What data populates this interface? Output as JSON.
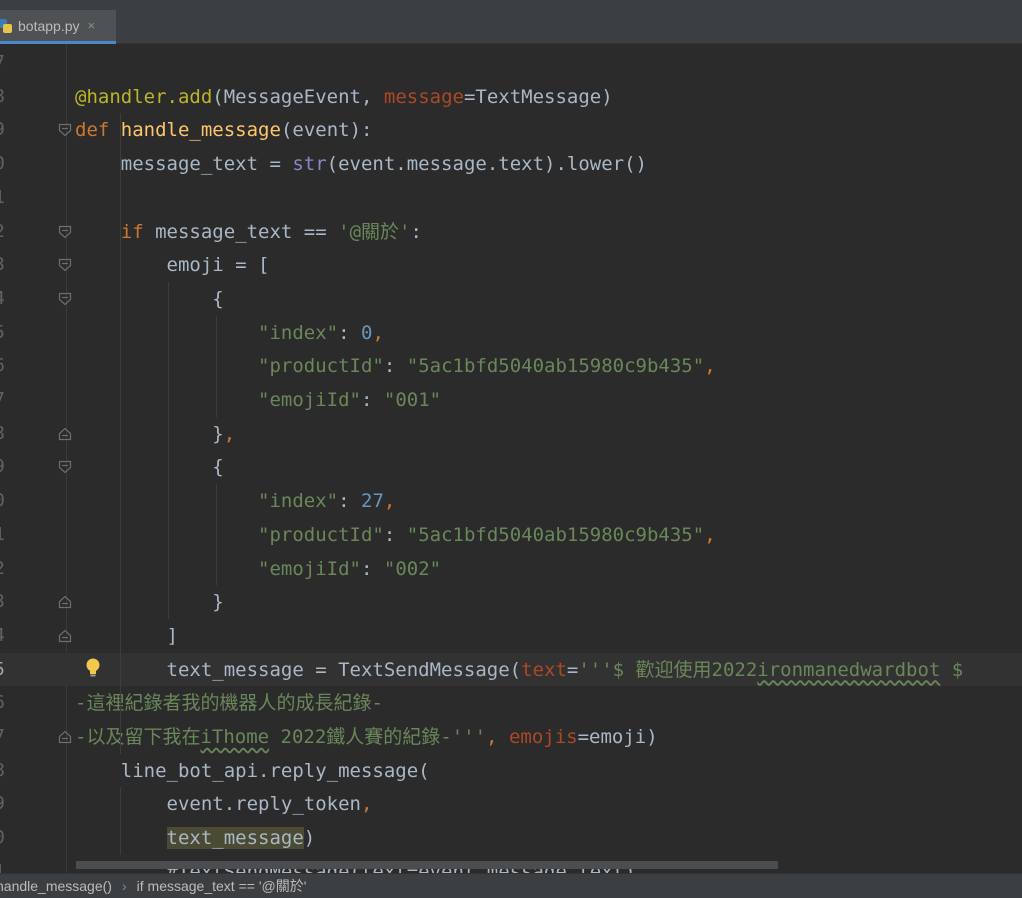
{
  "tab": {
    "filename": "botapp.py",
    "close_icon": "×"
  },
  "icons": {
    "file_icon": "python-file-icon",
    "intention_icon": "lightbulb-icon"
  },
  "lines": [
    {
      "num": "7",
      "html": ""
    },
    {
      "num": "8",
      "html": "<span class=\"dec\">@handler.add</span>(MessageEvent, <span class=\"kw\">message</span>=TextMessage)"
    },
    {
      "num": "9",
      "html": "<span class=\"k\">def</span> <span class=\"fn\">handle_message</span>(event):"
    },
    {
      "num": "0",
      "html": "    message_text = <span class=\"bi\">str</span>(event.message.text).lower()"
    },
    {
      "num": "1",
      "html": ""
    },
    {
      "num": "2",
      "html": "    <span class=\"k\">if</span> message_text == <span class=\"s\">'@關於'</span>:"
    },
    {
      "num": "3",
      "html": "        emoji = ["
    },
    {
      "num": "4",
      "html": "            {"
    },
    {
      "num": "5",
      "html": "                <span class=\"s\">\"index\"</span>: <span class=\"n\">0</span><span class=\"k\">,</span>"
    },
    {
      "num": "6",
      "html": "                <span class=\"s\">\"productId\"</span>: <span class=\"s\">\"5ac1bfd5040ab15980c9b435\"</span><span class=\"k\">,</span>"
    },
    {
      "num": "7",
      "html": "                <span class=\"s\">\"emojiId\"</span>: <span class=\"s\">\"001\"</span>"
    },
    {
      "num": "8",
      "html": "            }<span class=\"k\">,</span>"
    },
    {
      "num": "9",
      "html": "            {"
    },
    {
      "num": "0",
      "html": "                <span class=\"s\">\"index\"</span>: <span class=\"n\">27</span><span class=\"k\">,</span>"
    },
    {
      "num": "1",
      "html": "                <span class=\"s\">\"productId\"</span>: <span class=\"s\">\"5ac1bfd5040ab15980c9b435\"</span><span class=\"k\">,</span>"
    },
    {
      "num": "2",
      "html": "                <span class=\"s\">\"emojiId\"</span>: <span class=\"s\">\"002\"</span>"
    },
    {
      "num": "3",
      "html": "            }"
    },
    {
      "num": "4",
      "html": "        ]"
    },
    {
      "num": "5",
      "html": "        text_message = TextSendMessage(<span class=\"kw\">text</span>=<span class=\"s\">'''$ 歡迎使用2022<span class=\"wavy\">ironmanedwardbot</span> $</span>"
    },
    {
      "num": "6",
      "html": "<span class=\"s\">-這裡紀錄者我的機器人的成長紀錄-</span>"
    },
    {
      "num": "7",
      "html": "<span class=\"s\">-以及留下我在<span class=\"wavy\">iThome</span> 2022鐵人賽的紀錄-'''</span><span class=\"k\">,</span> <span class=\"kw\">emojis</span>=emoji)"
    },
    {
      "num": "8",
      "html": "    line_bot_api.reply_message("
    },
    {
      "num": "9",
      "html": "        event.reply_token<span class=\"k\">,</span>"
    },
    {
      "num": "0",
      "html": "        <span class=\"hl\">text_message</span>)"
    },
    {
      "num": "1",
      "html": "        #TextSendMessage(text=event.message.text)"
    }
  ],
  "breadcrumb": {
    "func": "handle_message()",
    "cond": "if message_text == '@關於'"
  },
  "colors": {
    "bg": "#2b2b2b",
    "keyword": "#cc7832",
    "string": "#6a8759",
    "number": "#6897bb",
    "function": "#ffc66d"
  }
}
